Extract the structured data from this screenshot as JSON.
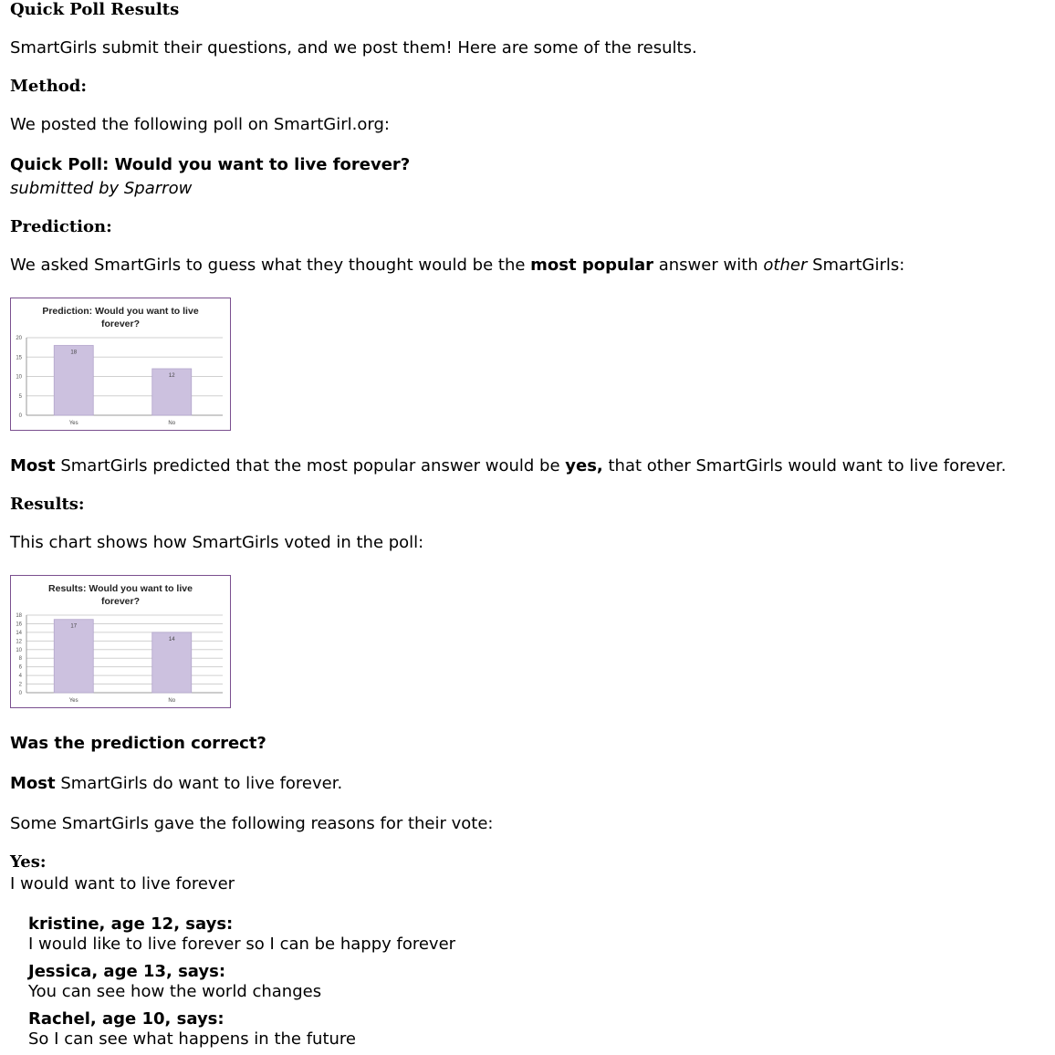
{
  "page": {
    "title": "Quick Poll Results",
    "intro": "SmartGirls submit their questions, and we post them! Here are some of the results.",
    "method_heading": "Method:",
    "method_text": "We posted the following poll on SmartGirl.org:",
    "poll_question": "Quick Poll: Would you want to live forever?",
    "poll_submitter": "submitted by Sparrow",
    "prediction_heading": "Prediction:",
    "prediction_text": {
      "part1": "We asked SmartGirls to guess what they thought would be the ",
      "bold": "most popular",
      "part2": " answer with ",
      "italic": "other",
      "part3": " SmartGirls:"
    },
    "prediction_summary": {
      "bold1": "Most",
      "part1": " SmartGirls predicted that the most popular answer would be ",
      "bold2": "yes,",
      "part2": " that other SmartGirls would want to live forever."
    },
    "results_heading": "Results:",
    "results_text": "This chart shows how SmartGirls voted in the poll:",
    "correct_heading": "Was the prediction correct?",
    "correct_text": {
      "bold": "Most",
      "rest": " SmartGirls do want to live forever."
    },
    "reasons_intro": "Some SmartGirls gave the following reasons for their vote:",
    "yes_heading": "Yes:",
    "yes_text": "I would want to live forever",
    "quotes": [
      {
        "who": "kristine, age 12, says:",
        "text": "I would like to live forever so I can be happy forever"
      },
      {
        "who": "Jessica, age 13, says:",
        "text": "You can see how the world changes"
      },
      {
        "who": "Rachel, age 10, says:",
        "text": "So I can see what happens in the future"
      }
    ]
  },
  "colors": {
    "bar": "#ccc1df",
    "bar_stroke": "#b3a6cc",
    "frame": "#7a4f8f",
    "grid": "#d0d0d0"
  },
  "chart_data": [
    {
      "type": "bar",
      "title": "Prediction: Would you want to live forever?",
      "title_lines": [
        "Prediction: Would you want to live",
        "forever?"
      ],
      "categories": [
        "Yes",
        "No"
      ],
      "values": [
        18,
        12
      ],
      "yticks": [
        0,
        5,
        10,
        15,
        20
      ],
      "ylim": [
        0,
        20
      ],
      "grid": true
    },
    {
      "type": "bar",
      "title": "Results: Would you want to live forever?",
      "title_lines": [
        "Results: Would you want to live",
        "forever?"
      ],
      "categories": [
        "Yes",
        "No"
      ],
      "values": [
        17,
        14
      ],
      "yticks": [
        0,
        2,
        4,
        6,
        8,
        10,
        12,
        14,
        16,
        18
      ],
      "ylim": [
        0,
        18
      ],
      "grid": true
    }
  ]
}
